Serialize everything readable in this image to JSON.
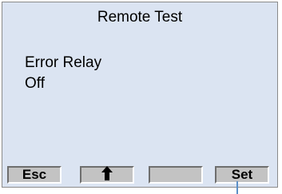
{
  "screen": {
    "title": "Remote Test",
    "parameter_name": "Error Relay",
    "parameter_value": "Off"
  },
  "softkeys": {
    "esc_label": "Esc",
    "up_icon": "up-arrow-icon",
    "blank_label": "",
    "set_label": "Set"
  },
  "colors": {
    "screen_background": "#dbe4f2",
    "softkey_face": "#c3c3c3",
    "pointer_line": "#5b8fc7"
  }
}
